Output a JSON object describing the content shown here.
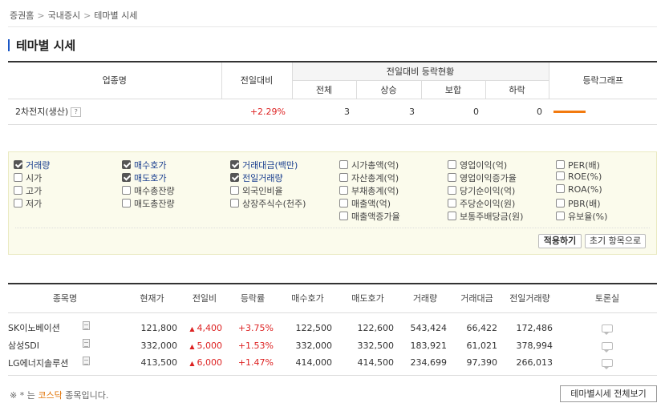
{
  "breadcrumb": [
    "증권홈",
    "국내증시",
    "테마별 시세"
  ],
  "page_title": "테마별 시세",
  "summary": {
    "headers": {
      "industry": "업종명",
      "change": "전일대비",
      "group": "전일대비 등락현황",
      "total": "전체",
      "rise": "상승",
      "flat": "보합",
      "fall": "하락",
      "graph": "등락그래프"
    },
    "row": {
      "name": "2차전지(생산)",
      "help": "?",
      "change": "+2.29%",
      "total": "3",
      "rise": "3",
      "flat": "0",
      "fall": "0",
      "rise_fraction": 1.0
    }
  },
  "filter": {
    "options": [
      {
        "label": "거래량",
        "checked": true
      },
      {
        "label": "시가",
        "checked": false
      },
      {
        "label": "고가",
        "checked": false
      },
      {
        "label": "저가",
        "checked": false
      },
      {
        "label": "매수호가",
        "checked": true
      },
      {
        "label": "매도호가",
        "checked": true
      },
      {
        "label": "매수총잔량",
        "checked": false
      },
      {
        "label": "매도총잔량",
        "checked": false
      },
      {
        "label": "거래대금(백만)",
        "checked": true
      },
      {
        "label": "전일거래량",
        "checked": true
      },
      {
        "label": "외국인비율",
        "checked": false
      },
      {
        "label": "상장주식수(천주)",
        "checked": false
      },
      {
        "label": "시가총액(억)",
        "checked": false
      },
      {
        "label": "자산총계(억)",
        "checked": false
      },
      {
        "label": "부채총계(억)",
        "checked": false
      },
      {
        "label": "매출액(억)",
        "checked": false
      },
      {
        "label": "매출액증가율",
        "checked": false
      },
      {
        "label": "영업이익(억)",
        "checked": false
      },
      {
        "label": "영업이익증가율",
        "checked": false
      },
      {
        "label": "당기순이익(억)",
        "checked": false
      },
      {
        "label": "주당순이익(원)",
        "checked": false
      },
      {
        "label": "보통주배당금(원)",
        "checked": false
      },
      {
        "label": "PER(배)",
        "checked": false
      },
      {
        "label": "ROE(%)",
        "checked": false
      },
      {
        "label": "ROA(%)",
        "checked": false
      },
      {
        "label": "PBR(배)",
        "checked": false
      },
      {
        "label": "유보율(%)",
        "checked": false
      }
    ],
    "apply_label": "적용하기",
    "reset_label": "초기 항목으로"
  },
  "stocks": {
    "headers": [
      "종목명",
      "현재가",
      "전일비",
      "등락률",
      "매수호가",
      "매도호가",
      "거래량",
      "거래대금",
      "전일거래량",
      "토론실"
    ],
    "rows": [
      {
        "name": "SK이노베이션",
        "price": "121,800",
        "diff": "4,400",
        "rate": "+3.75%",
        "bid": "122,500",
        "ask": "122,600",
        "volume": "543,424",
        "amount": "66,422",
        "prev_volume": "172,486"
      },
      {
        "name": "삼성SDI",
        "price": "332,000",
        "diff": "5,000",
        "rate": "+1.53%",
        "bid": "332,000",
        "ask": "332,500",
        "volume": "183,921",
        "amount": "61,021",
        "prev_volume": "378,994"
      },
      {
        "name": "LG에너지솔루션",
        "price": "413,500",
        "diff": "6,000",
        "rate": "+1.47%",
        "bid": "414,000",
        "ask": "414,500",
        "volume": "234,699",
        "amount": "97,390",
        "prev_volume": "266,013"
      }
    ]
  },
  "note": {
    "prefix": "※ * 는",
    "kosdaq": "코스닥",
    "suffix": "종목입니다."
  },
  "view_all_label": "테마별시세 전체보기",
  "colors": {
    "up": "#dd2222",
    "bar": "#f27a0e",
    "accent": "#1a57c6"
  }
}
